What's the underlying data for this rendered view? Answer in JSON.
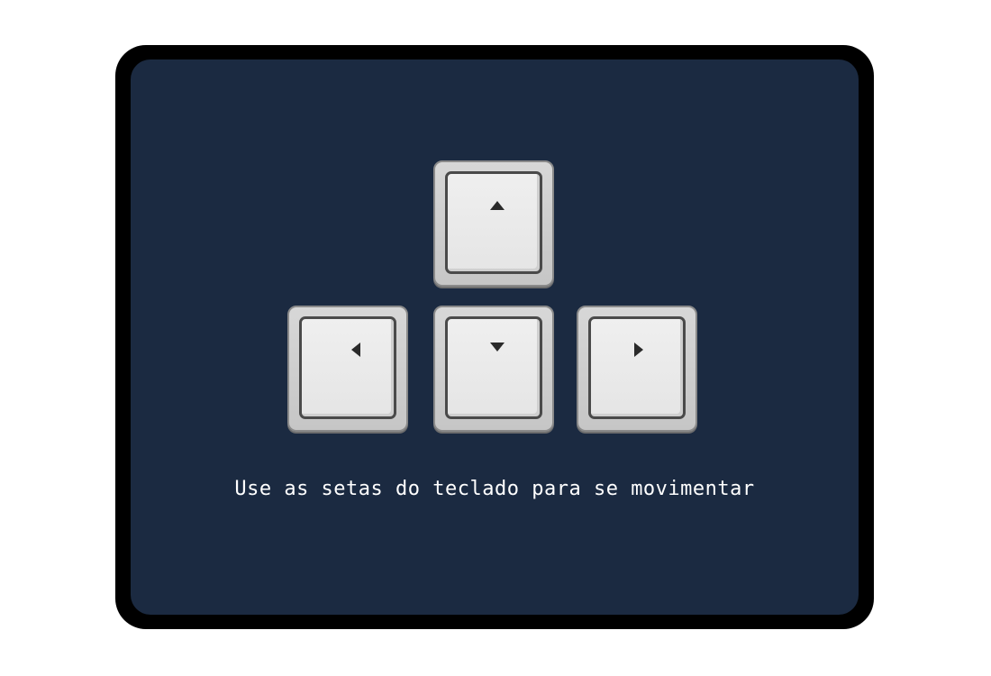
{
  "colors": {
    "panel_background": "#1b2a41",
    "frame_border": "#000000",
    "text": "#ffffff"
  },
  "keys": [
    {
      "direction": "up",
      "icon": "arrow-up-icon"
    },
    {
      "direction": "left",
      "icon": "arrow-left-icon"
    },
    {
      "direction": "down",
      "icon": "arrow-down-icon"
    },
    {
      "direction": "right",
      "icon": "arrow-right-icon"
    }
  ],
  "instruction_text": "Use as setas do teclado para se movimentar"
}
